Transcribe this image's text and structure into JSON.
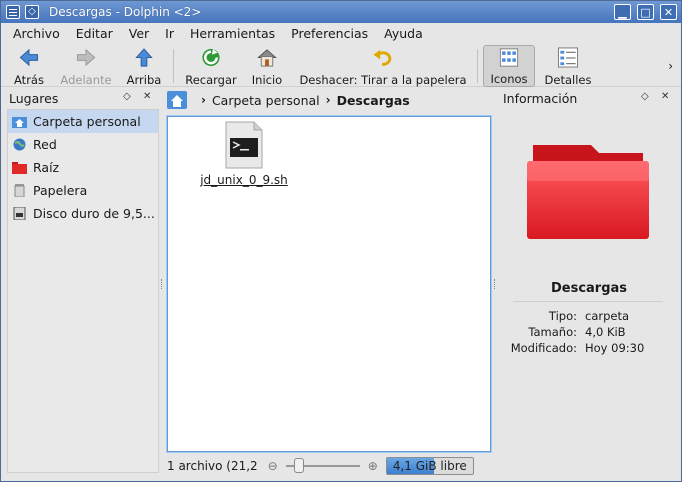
{
  "window": {
    "title": "Descargas - Dolphin <2>",
    "accent": "#4675bd"
  },
  "menu": [
    "Archivo",
    "Editar",
    "Ver",
    "Ir",
    "Herramientas",
    "Preferencias",
    "Ayuda"
  ],
  "toolbar": {
    "back": "Atrás",
    "forward": "Adelante",
    "up": "Arriba",
    "reload": "Recargar",
    "home": "Inicio",
    "undo": "Deshacer: Tirar a la papelera",
    "icons": "Iconos",
    "details": "Detalles"
  },
  "places": {
    "title": "Lugares",
    "items": [
      {
        "label": "Carpeta personal",
        "icon": "home-folder-icon",
        "selected": true
      },
      {
        "label": "Red",
        "icon": "network-globe-icon",
        "selected": false
      },
      {
        "label": "Raíz",
        "icon": "root-folder-icon",
        "selected": false
      },
      {
        "label": "Papelera",
        "icon": "trash-icon",
        "selected": false
      },
      {
        "label": "Disco duro de 9,5...",
        "icon": "harddisk-icon",
        "selected": false
      }
    ]
  },
  "breadcrumb": {
    "items": [
      "Carpeta personal",
      "Descargas"
    ]
  },
  "files": [
    {
      "name": "jd_unix_0_9.sh",
      "icon": "shell-script-icon"
    }
  ],
  "status": {
    "text": "1 archivo (21,2",
    "free_space": "4,1 GiB libre",
    "used_fraction": 0.55
  },
  "info": {
    "title": "Información",
    "name": "Descargas",
    "folder_color": "#e8232b",
    "rows": [
      {
        "key": "Tipo:",
        "value": "carpeta"
      },
      {
        "key": "Tamaño:",
        "value": "4,0 KiB"
      },
      {
        "key": "Modificado:",
        "value": "Hoy 09:30"
      }
    ]
  }
}
